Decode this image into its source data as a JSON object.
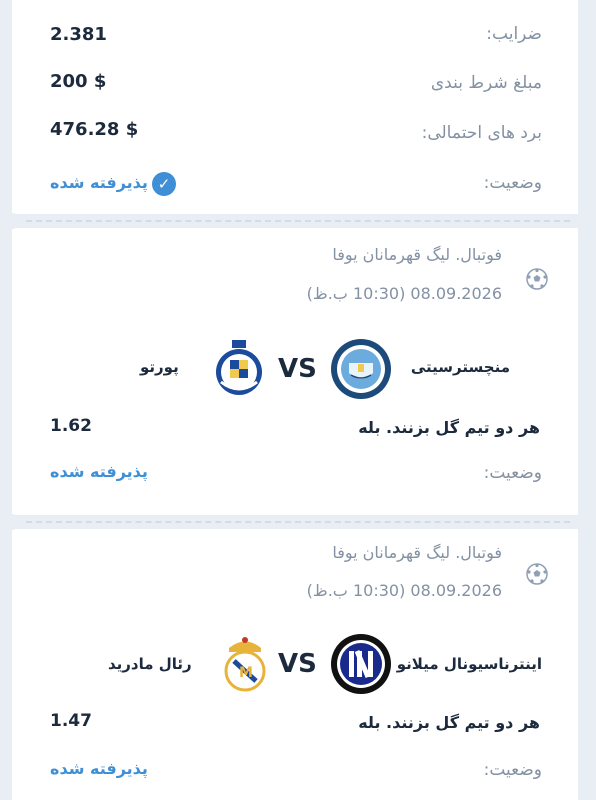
{
  "summary": {
    "odds_label": "ضرایب:",
    "odds_value": "2.381",
    "stake_label": "مبلغ شرط بندی",
    "stake_value": "200 $",
    "win_label": "برد های احتمالی:",
    "win_value": "476.28 $",
    "status_label": "وضعیت:",
    "status_value": "پذیرفته شده"
  },
  "bets": [
    {
      "league": "فوتبال. لیگ قهرمانان یوفا",
      "datetime": "08.09.2026 (10:30 ب.ظ)",
      "home_team": "منچسترسیتی",
      "away_team": "پورتو",
      "vs": "VS",
      "market": "هر دو تیم گل بزنند. بله",
      "odds": "1.62",
      "status_label": "وضعیت:",
      "status_value": "پذیرفته شده"
    },
    {
      "league": "فوتبال. لیگ قهرمانان یوفا",
      "datetime": "08.09.2026 (10:30 ب.ظ)",
      "home_team": "اینترناسیونال میلانو",
      "away_team": "رئال مادرید",
      "vs": "VS",
      "market": "هر دو تیم گل بزنند. بله",
      "odds": "1.47",
      "status_label": "وضعیت:",
      "status_value": "پذیرفته شده"
    }
  ],
  "colors": {
    "background": "#e9eef4",
    "accent": "#3f8fd6",
    "text": "#1c2a3d",
    "muted": "#8391a3"
  }
}
